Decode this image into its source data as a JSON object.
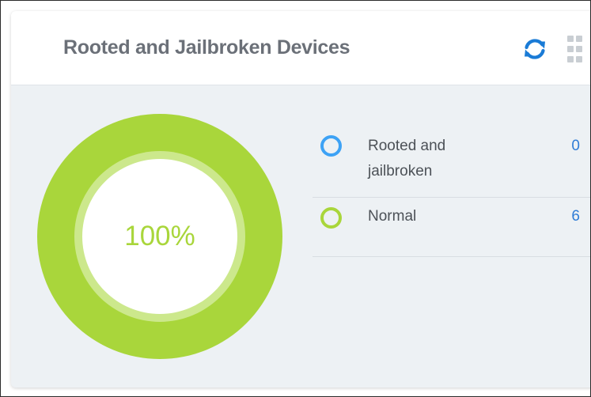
{
  "widget": {
    "title": "Rooted and Jailbroken Devices",
    "refresh_icon": "refresh-icon",
    "drag_icon": "grip-icon"
  },
  "donut": {
    "center_label": "100%",
    "colors": {
      "outer": "#a9d63b",
      "inner_ring": "#cce88c",
      "center": "#ffffff"
    }
  },
  "legend": [
    {
      "label": "Rooted and jailbroken",
      "count": "0",
      "color": "#3da2f5"
    },
    {
      "label": "Normal",
      "count": "6",
      "color": "#a9d63b"
    }
  ]
}
